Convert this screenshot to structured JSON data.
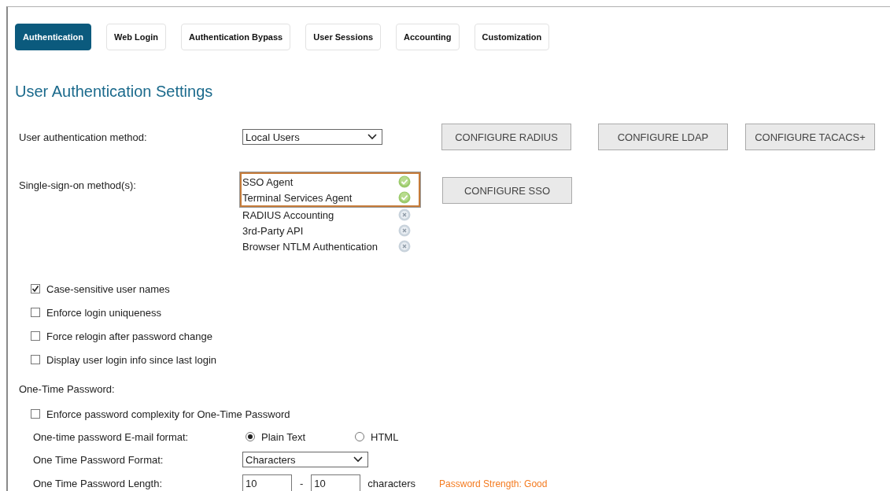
{
  "tabs": [
    {
      "label": "Authentication",
      "selected": true
    },
    {
      "label": "Web Login",
      "selected": false
    },
    {
      "label": "Authentication Bypass",
      "selected": false
    },
    {
      "label": "User Sessions",
      "selected": false
    },
    {
      "label": "Accounting",
      "selected": false
    },
    {
      "label": "Customization",
      "selected": false
    }
  ],
  "title": "User Authentication Settings",
  "auth_method": {
    "label": "User authentication method:",
    "value": "Local Users"
  },
  "configure_buttons": [
    "CONFIGURE RADIUS",
    "CONFIGURE LDAP",
    "CONFIGURE TACACS+"
  ],
  "sso": {
    "label": "Single-sign-on method(s):",
    "button": "CONFIGURE SSO",
    "methods": [
      {
        "name": "SSO Agent",
        "enabled": true
      },
      {
        "name": "Terminal Services Agent",
        "enabled": true
      },
      {
        "name": "RADIUS Accounting",
        "enabled": false
      },
      {
        "name": "3rd-Party API",
        "enabled": false
      },
      {
        "name": "Browser NTLM Authentication",
        "enabled": false
      }
    ]
  },
  "options": [
    {
      "label": "Case-sensitive user names",
      "checked": true
    },
    {
      "label": "Enforce login uniqueness",
      "checked": false
    },
    {
      "label": "Force relogin after password change",
      "checked": false
    },
    {
      "label": "Display user login info since last login",
      "checked": false
    }
  ],
  "otp": {
    "heading": "One-Time Password:",
    "complexity": {
      "label": "Enforce password complexity for One-Time Password",
      "checked": false
    },
    "email_format": {
      "label": "One-time password E-mail format:",
      "choices": [
        {
          "label": "Plain Text",
          "selected": true
        },
        {
          "label": "HTML",
          "selected": false
        }
      ]
    },
    "format": {
      "label": "One Time Password Format:",
      "value": "Characters"
    },
    "length": {
      "label": "One Time Password Length:",
      "min": "10",
      "separator": "-",
      "max": "10",
      "unit": "characters",
      "strength": "Password Strength: Good"
    }
  }
}
